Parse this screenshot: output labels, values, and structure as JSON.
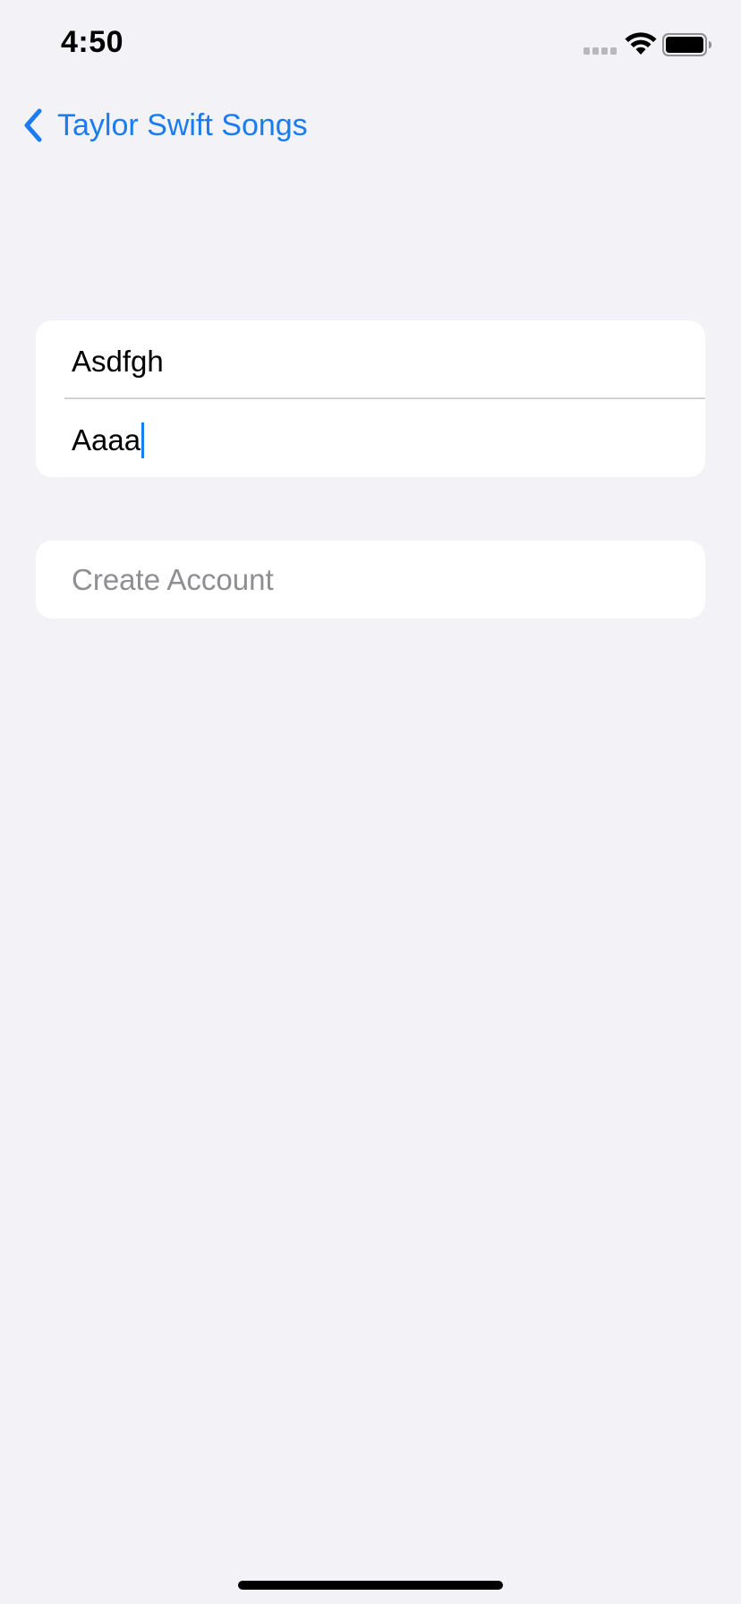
{
  "status_bar": {
    "time": "4:50"
  },
  "nav": {
    "back_label": "Taylor Swift Songs",
    "back_icon": "chevron-left-icon",
    "accent_color": "#1a7cf0"
  },
  "form": {
    "field_1_value": "Asdfgh",
    "field_2_value": "Aaaa"
  },
  "actions": {
    "create_account_label": "Create Account",
    "create_account_color": "#8e8e93"
  },
  "colors": {
    "background": "#f2f2f7",
    "card": "#ffffff"
  }
}
